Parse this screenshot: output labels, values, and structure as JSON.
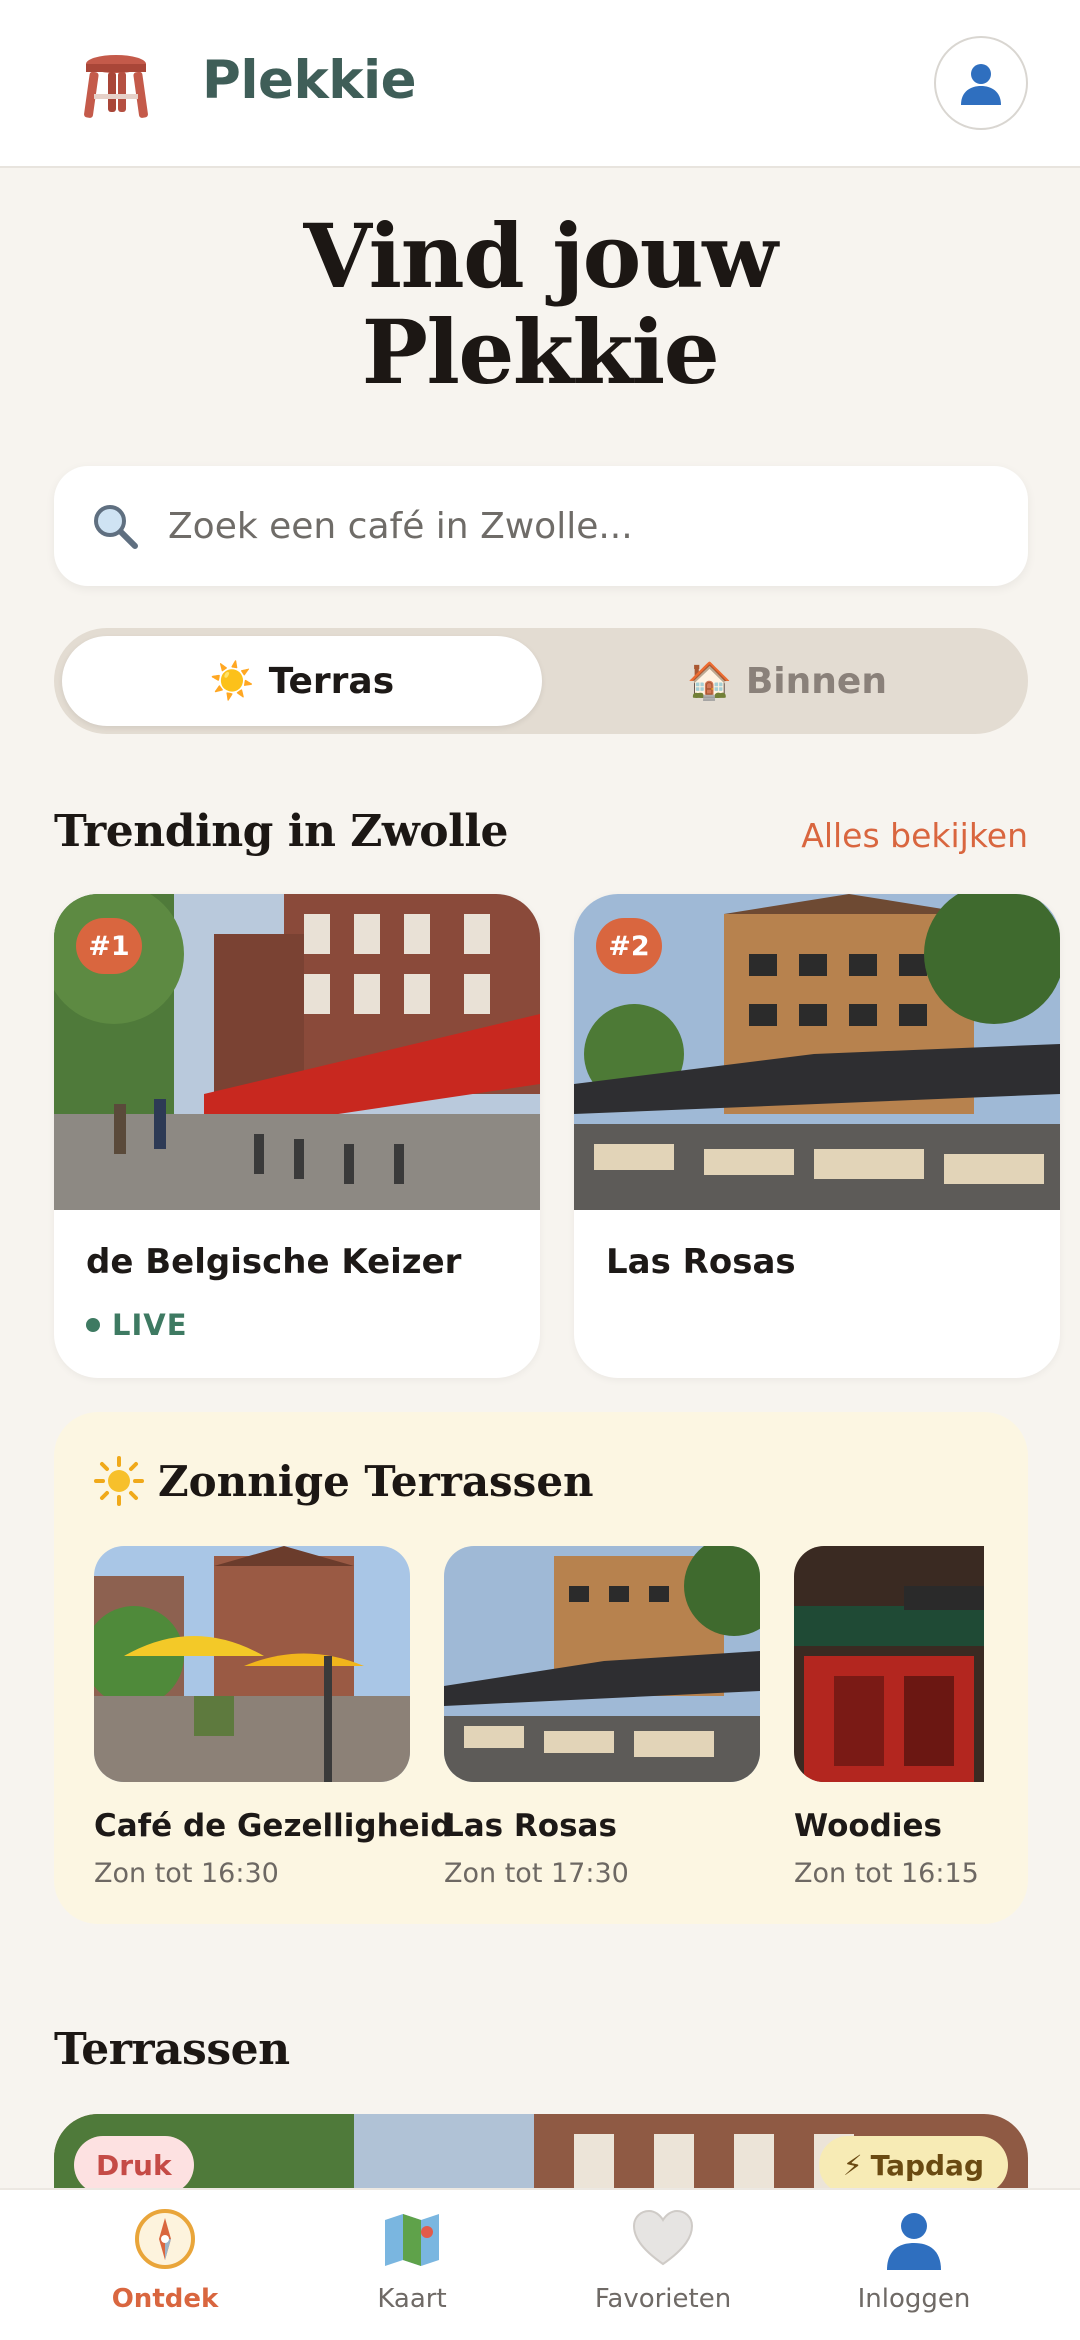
{
  "header": {
    "brand": "Plekkie",
    "logo_icon": "stool-icon",
    "account_icon": "user-icon"
  },
  "hero": {
    "line1": "Vind jouw",
    "line2": "Plekkie"
  },
  "search": {
    "placeholder": "Zoek een café in Zwolle..."
  },
  "toggle": {
    "options": [
      {
        "label": "Terras",
        "emoji": "☀️",
        "selected": true
      },
      {
        "label": "Binnen",
        "emoji": "🏠",
        "selected": false
      }
    ]
  },
  "trending": {
    "title": "Trending in Zwolle",
    "see_all": "Alles bekijken",
    "items": [
      {
        "rank": "#1",
        "name": "de Belgische Keizer",
        "status": "LIVE"
      },
      {
        "rank": "#2",
        "name": "Las Rosas",
        "status": ""
      }
    ]
  },
  "sunny": {
    "title": "Zonnige Terrassen",
    "items": [
      {
        "name": "Café de Gezelligheid",
        "sub": "Zon tot 16:30"
      },
      {
        "name": "Las Rosas",
        "sub": "Zon tot 17:30"
      },
      {
        "name": "Woodies",
        "sub": "Zon tot 16:15"
      }
    ]
  },
  "terrassen": {
    "title": "Terrassen",
    "badge_left": "Druk",
    "badge_right": "Tapdag",
    "badge_right_icon": "⚡"
  },
  "nav": {
    "items": [
      {
        "label": "Ontdek",
        "icon": "compass-icon",
        "active": true
      },
      {
        "label": "Kaart",
        "icon": "map-icon",
        "active": false
      },
      {
        "label": "Favorieten",
        "icon": "heart-icon",
        "active": false
      },
      {
        "label": "Inloggen",
        "icon": "user-icon",
        "active": false
      }
    ]
  },
  "colors": {
    "accent": "#d9663f",
    "brand": "#3f5e58",
    "live": "#3e7a62",
    "background": "#f7f4ef",
    "sunny_panel": "#fcf6e2"
  }
}
